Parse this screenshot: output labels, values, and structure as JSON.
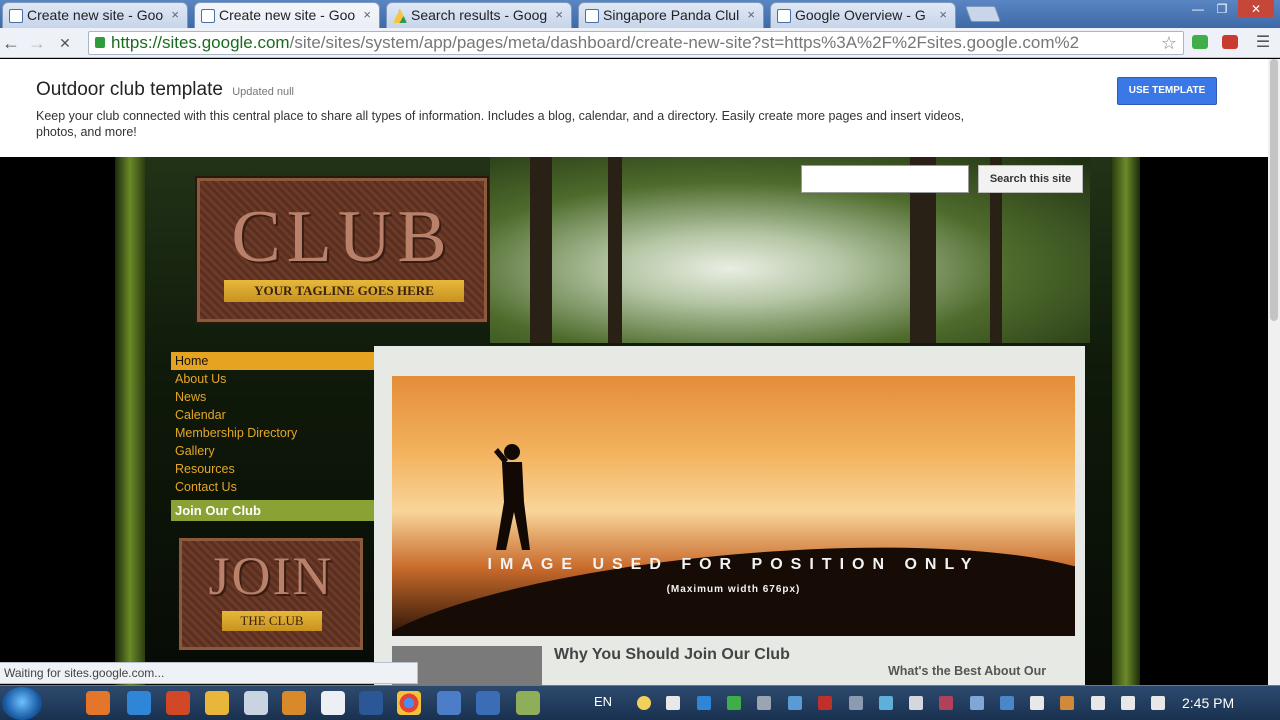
{
  "browser": {
    "tabs": [
      {
        "title": "Create new site - Goo"
      },
      {
        "title": "Create new site - Goo"
      },
      {
        "title": "Search results - Goog"
      },
      {
        "title": "Singapore Panda Clul"
      },
      {
        "title": "Google Overview - G"
      }
    ],
    "close_glyph": "×",
    "url_host": "https://sites.google.com",
    "url_path": "/site/sites/system/app/pages/meta/dashboard/create-new-site?st=https%3A%2F%2Fsites.google.com%2"
  },
  "template": {
    "name": "Outdoor club template",
    "updated": "Updated null",
    "description": "Keep your club connected with this central place to share all types of information. Includes a blog, calendar, and a directory. Easily create more pages and insert videos, photos, and more!",
    "use_button": "USE TEMPLATE"
  },
  "site": {
    "club_word": "CLUB",
    "tagline": "YOUR TAGLINE GOES HERE",
    "search_button": "Search this site",
    "nav": [
      "Home",
      "About Us",
      "News",
      "Calendar",
      "Membership Directory",
      "Gallery",
      "Resources",
      "Contact Us"
    ],
    "join_bar": "Join Our Club",
    "join_word": "JOIN",
    "join_sub": "THE CLUB",
    "hero_text": "IMAGE USED FOR POSITION ONLY",
    "hero_sub": "(Maximum width 676px)",
    "why_title": "Why You Should Join Our Club",
    "whats_best": "What's the Best About Our"
  },
  "status_text": "Waiting for sites.google.com...",
  "taskbar": {
    "lang": "EN",
    "time": "2:45 PM"
  }
}
